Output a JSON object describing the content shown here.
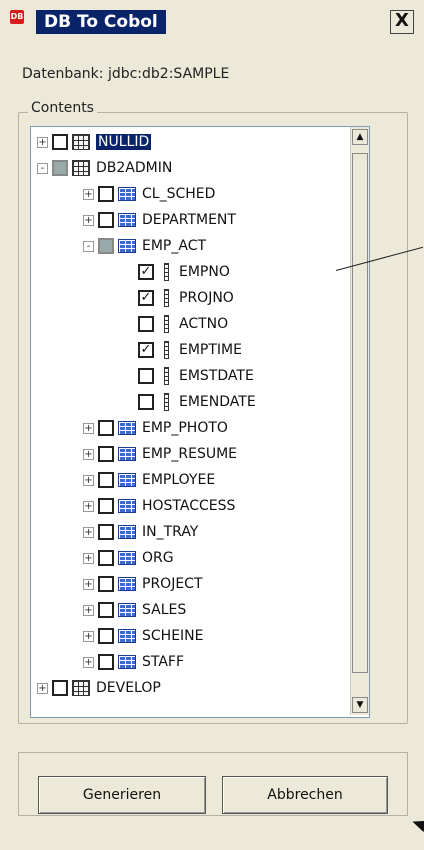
{
  "window": {
    "title": "DB To Cobol",
    "close_label": "X",
    "app_icon_label": "DB"
  },
  "database": {
    "label": "Datenbank: jdbc:db2:SAMPLE"
  },
  "contents_group": {
    "caption": "Contents"
  },
  "tree": {
    "items": [
      {
        "label": "NULLID",
        "level": 0,
        "expander": "+",
        "check": "unchecked",
        "icon": "schema-icon",
        "selected": true
      },
      {
        "label": "DB2ADMIN",
        "level": 0,
        "expander": "-",
        "check": "partial",
        "icon": "schema-icon"
      },
      {
        "label": "CL_SCHED",
        "level": 1,
        "expander": "+",
        "check": "unchecked",
        "icon": "table-icon"
      },
      {
        "label": "DEPARTMENT",
        "level": 1,
        "expander": "+",
        "check": "unchecked",
        "icon": "table-icon"
      },
      {
        "label": "EMP_ACT",
        "level": 1,
        "expander": "-",
        "check": "partial",
        "icon": "table-icon"
      },
      {
        "label": "EMPNO",
        "level": 2,
        "check": "checked",
        "icon": "column-icon"
      },
      {
        "label": "PROJNO",
        "level": 2,
        "check": "checked",
        "icon": "column-icon"
      },
      {
        "label": "ACTNO",
        "level": 2,
        "check": "unchecked",
        "icon": "column-icon"
      },
      {
        "label": "EMPTIME",
        "level": 2,
        "check": "checked",
        "icon": "column-icon"
      },
      {
        "label": "EMSTDATE",
        "level": 2,
        "check": "unchecked",
        "icon": "column-icon"
      },
      {
        "label": "EMENDATE",
        "level": 2,
        "check": "unchecked",
        "icon": "column-icon"
      },
      {
        "label": "EMP_PHOTO",
        "level": 1,
        "expander": "+",
        "check": "unchecked",
        "icon": "table-icon"
      },
      {
        "label": "EMP_RESUME",
        "level": 1,
        "expander": "+",
        "check": "unchecked",
        "icon": "table-icon"
      },
      {
        "label": "EMPLOYEE",
        "level": 1,
        "expander": "+",
        "check": "unchecked",
        "icon": "table-icon"
      },
      {
        "label": "HOSTACCESS",
        "level": 1,
        "expander": "+",
        "check": "unchecked",
        "icon": "table-icon"
      },
      {
        "label": "IN_TRAY",
        "level": 1,
        "expander": "+",
        "check": "unchecked",
        "icon": "table-icon"
      },
      {
        "label": "ORG",
        "level": 1,
        "expander": "+",
        "check": "unchecked",
        "icon": "table-icon"
      },
      {
        "label": "PROJECT",
        "level": 1,
        "expander": "+",
        "check": "unchecked",
        "icon": "table-icon"
      },
      {
        "label": "SALES",
        "level": 1,
        "expander": "+",
        "check": "unchecked",
        "icon": "table-icon"
      },
      {
        "label": "SCHEINE",
        "level": 1,
        "expander": "+",
        "check": "unchecked",
        "icon": "table-icon"
      },
      {
        "label": "STAFF",
        "level": 1,
        "expander": "+",
        "check": "unchecked",
        "icon": "table-icon"
      },
      {
        "label": "DEVELOP",
        "level": 0,
        "expander": "+",
        "check": "unchecked",
        "icon": "schema-icon"
      }
    ]
  },
  "scrollbar": {
    "up_glyph": "▲",
    "down_glyph": "▼"
  },
  "buttons": {
    "generate": "Generieren",
    "cancel": "Abbrechen"
  },
  "colors": {
    "title_bar": "#0a246a",
    "selection": "#0a246a",
    "window_bg": "#ece9d8",
    "table_icon": "#3a6ad4"
  }
}
